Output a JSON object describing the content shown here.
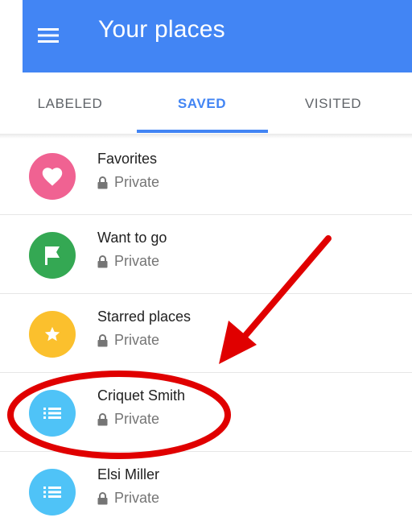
{
  "app": {
    "title": "Your places"
  },
  "tabs": [
    {
      "label": "LABELED"
    },
    {
      "label": "SAVED",
      "active": true
    },
    {
      "label": "VISITED"
    }
  ],
  "lists": [
    {
      "name": "Favorites",
      "privacy": "Private",
      "icon": "heart-icon",
      "color": "#f06292"
    },
    {
      "name": "Want to go",
      "privacy": "Private",
      "icon": "flag-icon",
      "color": "#34a853"
    },
    {
      "name": "Starred places",
      "privacy": "Private",
      "icon": "star-icon",
      "color": "#fbc02d"
    },
    {
      "name": "Criquet Smith",
      "privacy": "Private",
      "icon": "list-icon",
      "color": "#4fc3f7"
    },
    {
      "name": "Elsi Miller",
      "privacy": "Private",
      "icon": "list-icon",
      "color": "#4fc3f7"
    }
  ],
  "colors": {
    "header": "#4285f4",
    "active_tab": "#4285f4",
    "annotation": "#e00000"
  }
}
